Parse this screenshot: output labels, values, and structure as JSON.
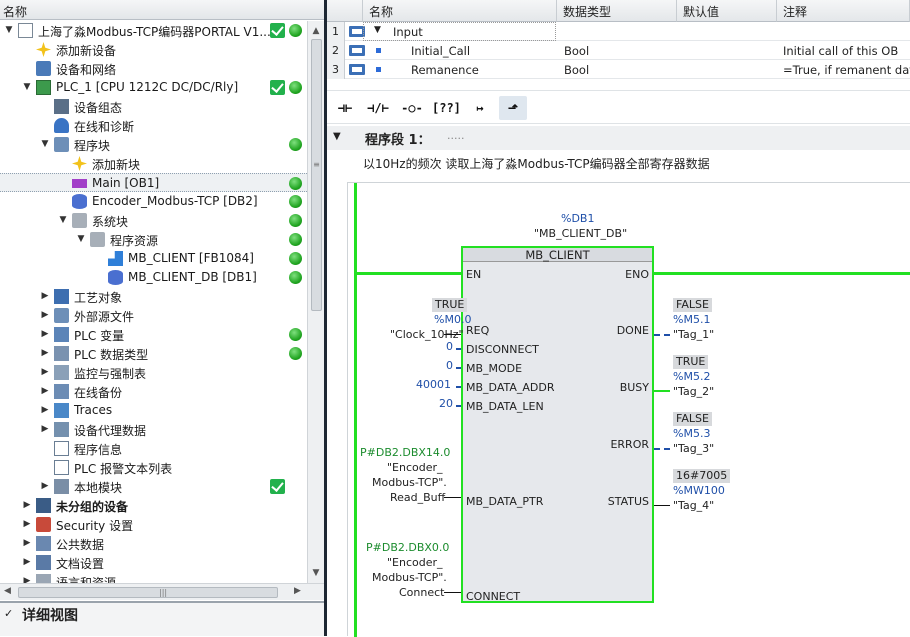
{
  "tree": {
    "header": "名称",
    "items": [
      {
        "label": "上海了淼Modbus-TCP编码器PORTAL V1...",
        "indent": 0,
        "arrow": "down",
        "icon": "project-icon",
        "check": true,
        "dot": true,
        "bold": false
      },
      {
        "label": "添加新设备",
        "indent": 1,
        "arrow": "",
        "icon": "add-device-icon",
        "check": false,
        "dot": false,
        "bold": false
      },
      {
        "label": "设备和网络",
        "indent": 1,
        "arrow": "",
        "icon": "network-icon",
        "check": false,
        "dot": false,
        "bold": false
      },
      {
        "label": "PLC_1 [CPU 1212C DC/DC/Rly]",
        "indent": 1,
        "arrow": "down",
        "icon": "plc-icon",
        "check": true,
        "dot": true,
        "bold": false
      },
      {
        "label": "设备组态",
        "indent": 2,
        "arrow": "",
        "icon": "device-config-icon",
        "check": false,
        "dot": false,
        "bold": false
      },
      {
        "label": "在线和诊断",
        "indent": 2,
        "arrow": "",
        "icon": "diagnostics-icon",
        "check": false,
        "dot": false,
        "bold": false
      },
      {
        "label": "程序块",
        "indent": 2,
        "arrow": "down",
        "icon": "folder-icon",
        "check": false,
        "dot": true,
        "bold": false
      },
      {
        "label": "添加新块",
        "indent": 3,
        "arrow": "",
        "icon": "add-block-icon",
        "check": false,
        "dot": false,
        "bold": false
      },
      {
        "label": "Main [OB1]",
        "indent": 3,
        "arrow": "",
        "icon": "ob-icon",
        "check": false,
        "dot": true,
        "bold": false,
        "selected": true
      },
      {
        "label": "Encoder_Modbus-TCP [DB2]",
        "indent": 3,
        "arrow": "",
        "icon": "db-icon",
        "check": false,
        "dot": true,
        "bold": false
      },
      {
        "label": "系统块",
        "indent": 3,
        "arrow": "down",
        "icon": "folder-gray-icon",
        "check": false,
        "dot": true,
        "bold": false
      },
      {
        "label": "程序资源",
        "indent": 4,
        "arrow": "down",
        "icon": "folder-gray-icon",
        "check": false,
        "dot": true,
        "bold": false
      },
      {
        "label": "MB_CLIENT [FB1084]",
        "indent": 5,
        "arrow": "",
        "icon": "fb-icon",
        "check": false,
        "dot": true,
        "bold": false
      },
      {
        "label": "MB_CLIENT_DB [DB1]",
        "indent": 5,
        "arrow": "",
        "icon": "db-icon",
        "check": false,
        "dot": true,
        "bold": false
      },
      {
        "label": "工艺对象",
        "indent": 2,
        "arrow": "right",
        "icon": "tech-object-icon",
        "check": false,
        "dot": false,
        "bold": false
      },
      {
        "label": "外部源文件",
        "indent": 2,
        "arrow": "right",
        "icon": "folder-icon",
        "check": false,
        "dot": false,
        "bold": false
      },
      {
        "label": "PLC 变量",
        "indent": 2,
        "arrow": "right",
        "icon": "tag-table-icon",
        "check": false,
        "dot": true,
        "bold": false
      },
      {
        "label": "PLC 数据类型",
        "indent": 2,
        "arrow": "right",
        "icon": "data-type-icon",
        "check": false,
        "dot": true,
        "bold": false
      },
      {
        "label": "监控与强制表",
        "indent": 2,
        "arrow": "right",
        "icon": "watch-table-icon",
        "check": false,
        "dot": false,
        "bold": false
      },
      {
        "label": "在线备份",
        "indent": 2,
        "arrow": "right",
        "icon": "backup-icon",
        "check": false,
        "dot": false,
        "bold": false
      },
      {
        "label": "Traces",
        "indent": 2,
        "arrow": "right",
        "icon": "traces-icon",
        "check": false,
        "dot": false,
        "bold": false
      },
      {
        "label": "设备代理数据",
        "indent": 2,
        "arrow": "right",
        "icon": "proxy-data-icon",
        "check": false,
        "dot": false,
        "bold": false
      },
      {
        "label": "程序信息",
        "indent": 2,
        "arrow": "",
        "icon": "program-info-icon",
        "check": false,
        "dot": false,
        "bold": false
      },
      {
        "label": "PLC 报警文本列表",
        "indent": 2,
        "arrow": "",
        "icon": "alarm-text-icon",
        "check": false,
        "dot": false,
        "bold": false
      },
      {
        "label": "本地模块",
        "indent": 2,
        "arrow": "right",
        "icon": "local-module-icon",
        "check": true,
        "dot": false,
        "bold": false
      },
      {
        "label": "未分组的设备",
        "indent": 1,
        "arrow": "right",
        "icon": "ungrouped-devices-icon",
        "check": false,
        "dot": false,
        "bold": true
      },
      {
        "label": "Security 设置",
        "indent": 1,
        "arrow": "right",
        "icon": "security-icon",
        "check": false,
        "dot": false,
        "bold": false
      },
      {
        "label": "公共数据",
        "indent": 1,
        "arrow": "right",
        "icon": "common-data-icon",
        "check": false,
        "dot": false,
        "bold": false
      },
      {
        "label": "文档设置",
        "indent": 1,
        "arrow": "right",
        "icon": "doc-settings-icon",
        "check": false,
        "dot": false,
        "bold": false
      },
      {
        "label": "语言和资源",
        "indent": 1,
        "arrow": "right",
        "icon": "language-icon",
        "check": false,
        "dot": false,
        "bold": false
      }
    ]
  },
  "detail_view": {
    "title": "详细视图"
  },
  "interface": {
    "columns": [
      "名称",
      "数据类型",
      "默认值",
      "注释"
    ],
    "rows": [
      {
        "num": "1",
        "name": "Input",
        "type": "",
        "default": "",
        "comment": "",
        "section": true
      },
      {
        "num": "2",
        "name": "Initial_Call",
        "type": "Bool",
        "default": "",
        "comment": "Initial call of this OB"
      },
      {
        "num": "3",
        "name": "Remanence",
        "type": "Bool",
        "default": "",
        "comment": "=True, if remanent data"
      }
    ]
  },
  "toolbar": {
    "buttons": [
      {
        "name": "no-contact-button",
        "glyph": "⊣⊢"
      },
      {
        "name": "nc-contact-button",
        "glyph": "⊣/⊢"
      },
      {
        "name": "coil-button",
        "glyph": "-○-"
      },
      {
        "name": "empty-box-button",
        "glyph": "[??]"
      },
      {
        "name": "open-branch-button",
        "glyph": "↦"
      },
      {
        "name": "close-branch-button",
        "glyph": "⬏"
      }
    ]
  },
  "network": {
    "title": "程序段 1：",
    "title_dots": ".....",
    "comment": "以10Hz的频次 读取上海了淼Modbus-TCP编码器全部寄存器数据",
    "instance_db": "%DB1",
    "instance_db_name": "\"MB_CLIENT_DB\"",
    "block_name": "MB_CLIENT",
    "inputs": {
      "en": "EN",
      "req": {
        "pin": "REQ",
        "value": "TRUE",
        "address": "%M0.0",
        "tag": "\"Clock_10Hz\""
      },
      "disconnect": {
        "pin": "DISCONNECT",
        "actual": "0"
      },
      "mb_mode": {
        "pin": "MB_MODE",
        "actual": "0"
      },
      "mb_data_addr": {
        "pin": "MB_DATA_ADDR",
        "actual": "40001"
      },
      "mb_data_len": {
        "pin": "MB_DATA_LEN",
        "actual": "20"
      },
      "mb_data_ptr": {
        "pin": "MB_DATA_PTR",
        "address": "P#DB2.DBX14.0",
        "line1": "\"Encoder_",
        "line2": "Modbus-TCP\".",
        "line3": "Read_Buff"
      },
      "connect": {
        "pin": "CONNECT",
        "address": "P#DB2.DBX0.0",
        "line1": "\"Encoder_",
        "line2": "Modbus-TCP\".",
        "line3": "Connect"
      }
    },
    "outputs": {
      "eno": "ENO",
      "done": {
        "pin": "DONE",
        "value": "FALSE",
        "address": "%M5.1",
        "tag": "\"Tag_1\""
      },
      "busy": {
        "pin": "BUSY",
        "value": "TRUE",
        "address": "%M5.2",
        "tag": "\"Tag_2\""
      },
      "error": {
        "pin": "ERROR",
        "value": "FALSE",
        "address": "%M5.3",
        "tag": "\"Tag_3\""
      },
      "status": {
        "pin": "STATUS",
        "value": "16#7005",
        "address": "%MW100",
        "tag": "\"Tag_4\""
      }
    }
  },
  "colors": {
    "energized": "#22e022",
    "address_blue": "#1f4fa8",
    "status_green": "#22b14c",
    "splitter": "#1d2733"
  }
}
